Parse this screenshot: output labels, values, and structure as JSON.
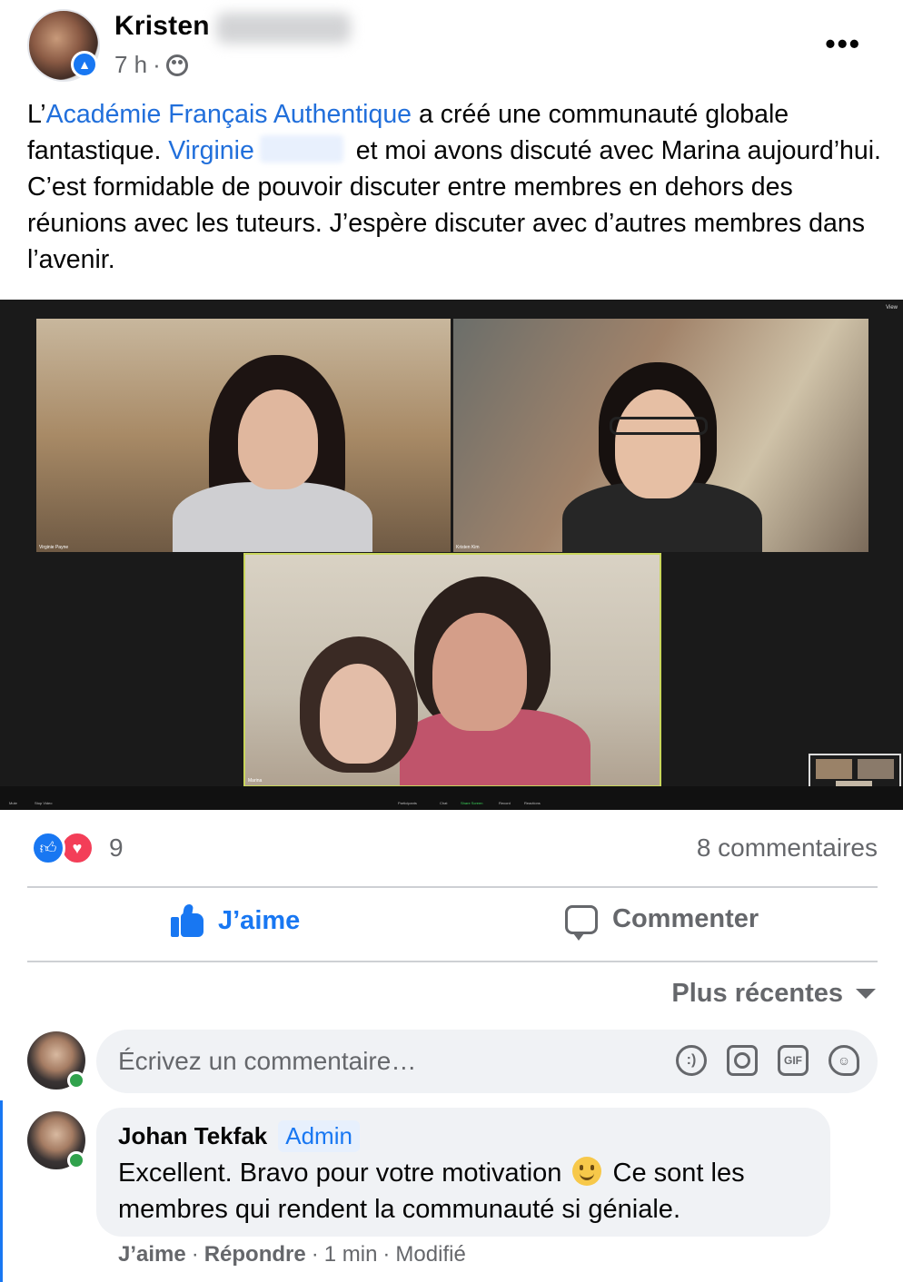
{
  "post": {
    "author_first_name": "Kristen",
    "time": "7 h",
    "time_separator": "·",
    "more_label": "•••",
    "text": {
      "p1": "L’",
      "link1": "Académie Français Authentique",
      "p2": " a créé une communauté globale fantastique. ",
      "link2": "Virginie",
      "p3": " et moi avons discuté avec Marina aujourd’hui. C’est formidable de pouvoir discuter entre membres en dehors des réunions avec les tuteurs. J’espère discuter avec d’autres membres dans l’avenir."
    }
  },
  "video_call": {
    "tiles": [
      {
        "label": "Virginie Payne"
      },
      {
        "label": "Kristen Kim"
      },
      {
        "label": "Marina"
      }
    ],
    "toolbar": [
      "Mute",
      "Stop Video",
      "Participants",
      "Chat",
      "Share Screen",
      "Record",
      "Reactions"
    ],
    "view_label": "View"
  },
  "stats": {
    "reaction_count": "9",
    "comments_label": "8 commentaires"
  },
  "actions": {
    "like_label": "J’aime",
    "comment_label": "Commenter"
  },
  "sort": {
    "label": "Plus récentes"
  },
  "composer": {
    "placeholder": "Écrivez un commentaire…",
    "gif_label": "GIF"
  },
  "comment": {
    "author": "Johan Tekfak",
    "badge": "Admin",
    "text_before": "Excellent. Bravo pour votre motivation ",
    "text_after": " Ce sont les membres qui rendent la communauté si géniale.",
    "like_label": "J’aime",
    "reply_label": "Répondre",
    "time": "1 min",
    "edited_label": "Modifié",
    "sep": "·"
  },
  "colors": {
    "accent": "#1877f2",
    "link": "#216fdb",
    "muted": "#65676b",
    "love": "#f33e58",
    "online": "#31a24c"
  }
}
